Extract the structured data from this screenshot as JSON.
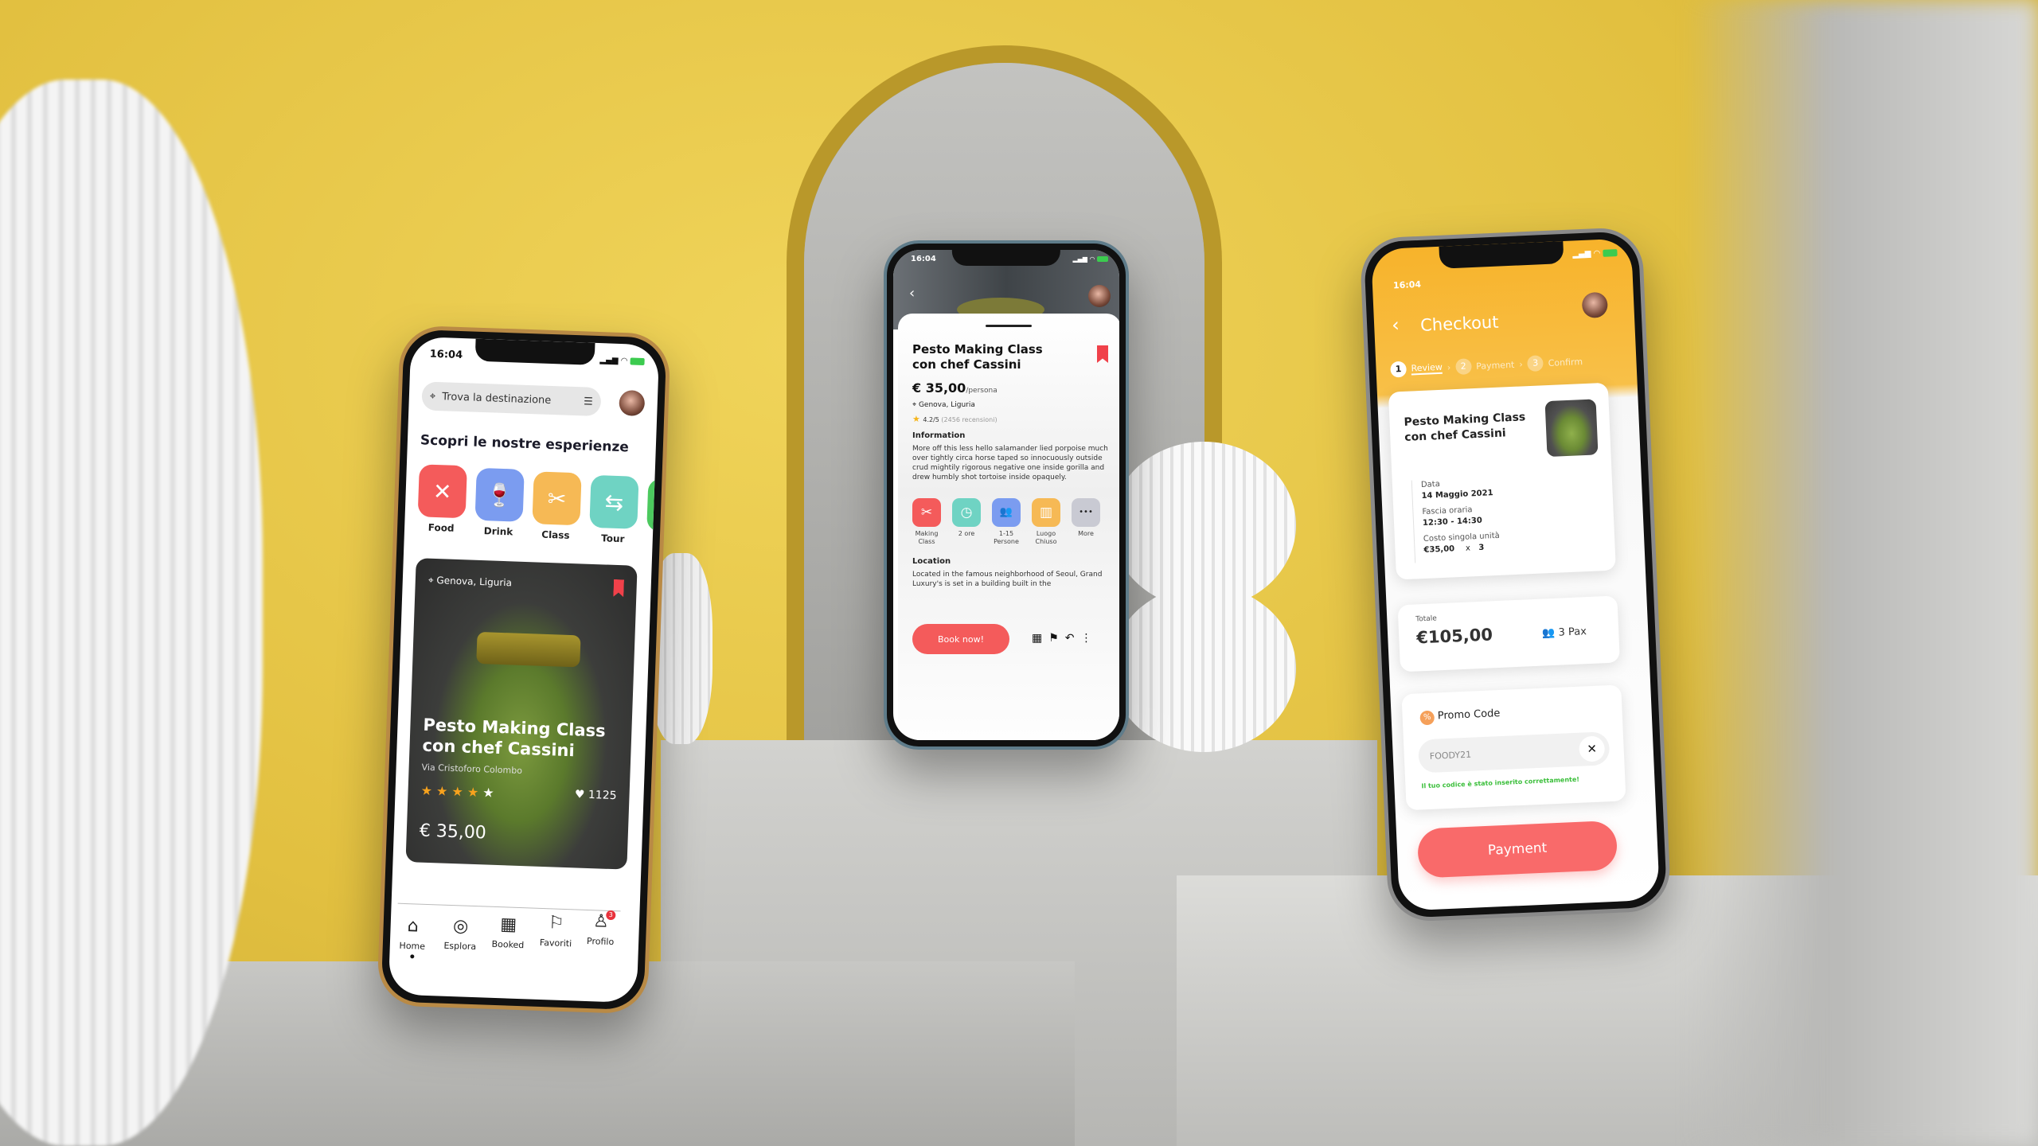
{
  "colors": {
    "accent_red": "#f45b5b",
    "checkout_orange": "#f7b32b",
    "success_green": "#3bbf3b",
    "food": "#f45b5b",
    "drink": "#7b9cf0",
    "class": "#f6b955",
    "tour": "#6fd3c3"
  },
  "home_screen": {
    "time": "16:04",
    "search": {
      "placeholder": "Trova la destinazione",
      "icon": "map-pin-icon",
      "filter_icon": "sliders-icon"
    },
    "heading": "Scopri le nostre esperienze",
    "categories": [
      {
        "label": "Food",
        "icon": "fork-spoon-icon",
        "glyph": "✕"
      },
      {
        "label": "Drink",
        "icon": "wine-glass-icon",
        "glyph": "🍷"
      },
      {
        "label": "Class",
        "icon": "cooking-tools-icon",
        "glyph": "✂"
      },
      {
        "label": "Tour",
        "icon": "signpost-icon",
        "glyph": "⇆"
      }
    ],
    "featured_card": {
      "location": "Genova, Liguria",
      "title_line1": "Pesto Making Class",
      "title_line2": "con chef Cassini",
      "address": "Via Cristoforo Colombo",
      "rating": 4,
      "rating_max": 5,
      "likes": "1125",
      "price": "€ 35,00"
    },
    "tabbar": [
      {
        "label": "Home",
        "icon": "home-icon",
        "glyph": "⌂",
        "active": true
      },
      {
        "label": "Esplora",
        "icon": "compass-icon",
        "glyph": "◎"
      },
      {
        "label": "Booked",
        "icon": "calendar-icon",
        "glyph": "▦"
      },
      {
        "label": "Favoriti",
        "icon": "bookmark-icon",
        "glyph": "⚐"
      },
      {
        "label": "Profilo",
        "icon": "user-icon",
        "glyph": "♙",
        "badge": "3"
      }
    ]
  },
  "detail_screen": {
    "time": "16:04",
    "title_line1": "Pesto Making Class",
    "title_line2": "con chef Cassini",
    "price": "€ 35,00",
    "price_unit": "/persona",
    "location": "Genova, Liguria",
    "rating": "4.2/5",
    "reviews": "(2456 recensioni)",
    "info_heading": "Information",
    "info_text": "More off this less hello salamander lied porpoise much over tightly circa horse taped so innocuously outside crud mightily rigorous negative one inside gorilla and drew humbly shot tortoise inside opaquely.",
    "features": [
      {
        "label": "Making Class",
        "icon": "cooking-tools-icon",
        "glyph": "✂",
        "color": "#f45b5b"
      },
      {
        "label": "2 ore",
        "icon": "clock-icon",
        "glyph": "◷",
        "color": "#6fd3c3"
      },
      {
        "label": "1-15 Persone",
        "icon": "people-icon",
        "glyph": "👥",
        "color": "#7b9cf0"
      },
      {
        "label": "Luogo Chiuso",
        "icon": "building-icon",
        "glyph": "▥",
        "color": "#f6b955"
      },
      {
        "label": "More",
        "icon": "more-icon",
        "glyph": "•••",
        "color": "#c9cad3"
      }
    ],
    "location_heading": "Location",
    "location_text": "Located in the famous neighborhood of Seoul, Grand Luxury's is set in a building built in the",
    "book_button": "Book now!"
  },
  "checkout_screen": {
    "time": "16:04",
    "title": "Checkout",
    "steps": [
      {
        "num": "1",
        "label": "Review",
        "active": true
      },
      {
        "num": "2",
        "label": "Payment"
      },
      {
        "num": "3",
        "label": "Confirm"
      }
    ],
    "item_title_line1": "Pesto Making Class",
    "item_title_line2": "con chef Cassini",
    "details": [
      {
        "label": "Data",
        "value": "14 Maggio 2021"
      },
      {
        "label": "Fascia oraria",
        "value": "12:30 - 14:30"
      },
      {
        "label": "Costo singola unità",
        "value": "€35,00",
        "qty_sep": "x",
        "qty": "3"
      }
    ],
    "total_label": "Totale",
    "total_value": "€105,00",
    "pax": "3 Pax",
    "promo_heading": "Promo Code",
    "promo_value": "FOODY21",
    "promo_success": "Il tuo codice è stato inserito correttamente!",
    "payment_button": "Payment"
  }
}
